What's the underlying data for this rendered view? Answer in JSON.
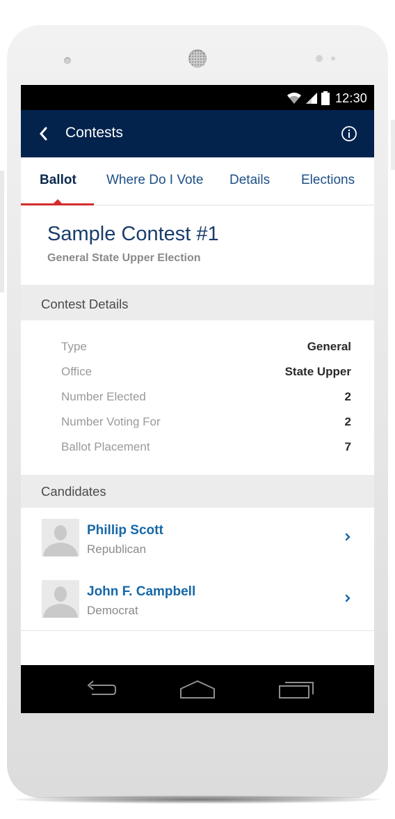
{
  "status_bar": {
    "time": "12:30",
    "icons": [
      "wifi-icon",
      "signal-icon",
      "battery-icon"
    ]
  },
  "app_bar": {
    "back_icon": "chevron-left-icon",
    "title": "Contests",
    "info_icon": "info-icon"
  },
  "tabs": [
    {
      "label": "Ballot",
      "active": true
    },
    {
      "label": "Where Do I Vote",
      "active": false
    },
    {
      "label": "Details",
      "active": false
    },
    {
      "label": "Elections",
      "active": false
    }
  ],
  "contest": {
    "title": "Sample Contest #1",
    "subtitle": "General State Upper Election"
  },
  "contest_details": {
    "header": "Contest Details",
    "rows": [
      {
        "label": "Type",
        "value": "General"
      },
      {
        "label": "Office",
        "value": "State Upper"
      },
      {
        "label": "Number Elected",
        "value": "2"
      },
      {
        "label": "Number Voting For",
        "value": "2"
      },
      {
        "label": "Ballot Placement",
        "value": "7"
      }
    ]
  },
  "candidates": {
    "header": "Candidates",
    "items": [
      {
        "name": "Phillip Scott",
        "party": "Republican"
      },
      {
        "name": "John F. Campbell",
        "party": "Democrat"
      }
    ]
  },
  "nav_bar": {
    "icons": [
      "nav-back-icon",
      "nav-home-icon",
      "nav-recent-apps-icon"
    ]
  },
  "colors": {
    "app_bar": "#03234d",
    "tab_indicator": "#d42c2c",
    "candidate_name": "#1667a8",
    "section_header_bg": "#ececec"
  }
}
